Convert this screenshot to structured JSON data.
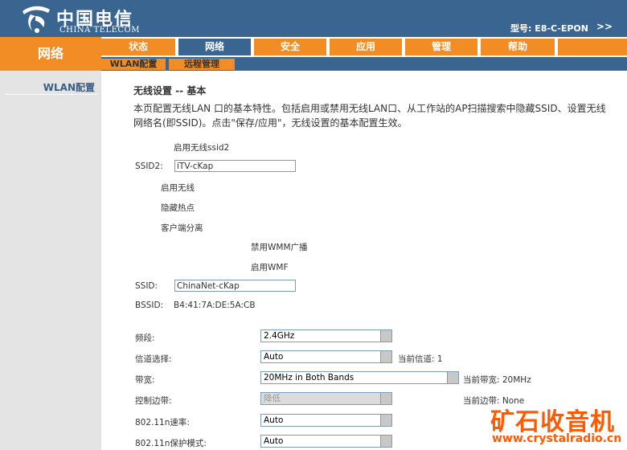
{
  "brand": {
    "name_cn": "中国电信",
    "name_en": "CHINA TELECOM",
    "color": "#3a6591",
    "accent": "#f18d24"
  },
  "header": {
    "model_label": "型号: E8-C-EPON",
    "more": ">>"
  },
  "section_title": "网络",
  "nav": {
    "tabs": [
      {
        "label": "状态",
        "active": false
      },
      {
        "label": "网络",
        "active": true
      },
      {
        "label": "安全",
        "active": false
      },
      {
        "label": "应用",
        "active": false
      },
      {
        "label": "管理",
        "active": false
      },
      {
        "label": "帮助",
        "active": false
      }
    ],
    "subtabs": [
      {
        "label": "WLAN配置"
      },
      {
        "label": "远程管理"
      }
    ]
  },
  "sidebar": {
    "items": [
      {
        "label": "WLAN配置"
      }
    ]
  },
  "page": {
    "title": "无线设置 -- 基本",
    "description": "本页配置无线LAN 口的基本特性。包括启用或禁用无线LAN口、从工作站的AP扫描搜索中隐藏SSID、设置无线网络名(即SSID)。点击\"保存/应用\"，无线设置的基本配置生效。",
    "enable_ssid2_label": "启用无线ssid2",
    "ssid2_label": "SSID2:",
    "ssid2_value": "iTV-cKap",
    "enable_wireless_label": "启用无线",
    "hide_ap_label": "隐藏热点",
    "client_isolation_label": "客户端分离",
    "disable_wmm_label": "禁用WMM广播",
    "enable_wmf_label": "启用WMF",
    "ssid_label": "SSID:",
    "ssid_value": "ChinaNet-cKap",
    "bssid_label": "BSSID:",
    "bssid_value": "B4:41:7A:DE:5A:CB",
    "band_label": "频段:",
    "band_value": "2.4GHz",
    "channel_label": "信道选择:",
    "channel_value": "Auto",
    "current_channel": "当前信道: 1",
    "bandwidth_label": "带宽:",
    "bandwidth_value": "20MHz in Both Bands",
    "current_bandwidth": "当前带宽: 20MHz",
    "sideband_label": "控制边带:",
    "sideband_value": "降低",
    "current_sideband": "当前边带: None",
    "rate_label": "802.11n速率:",
    "rate_value": "Auto",
    "protection_label": "802.11n保护模式:",
    "protection_value": "Auto"
  },
  "watermark": {
    "cn": "矿石收音机",
    "url": "www.crystalradio.cn"
  }
}
